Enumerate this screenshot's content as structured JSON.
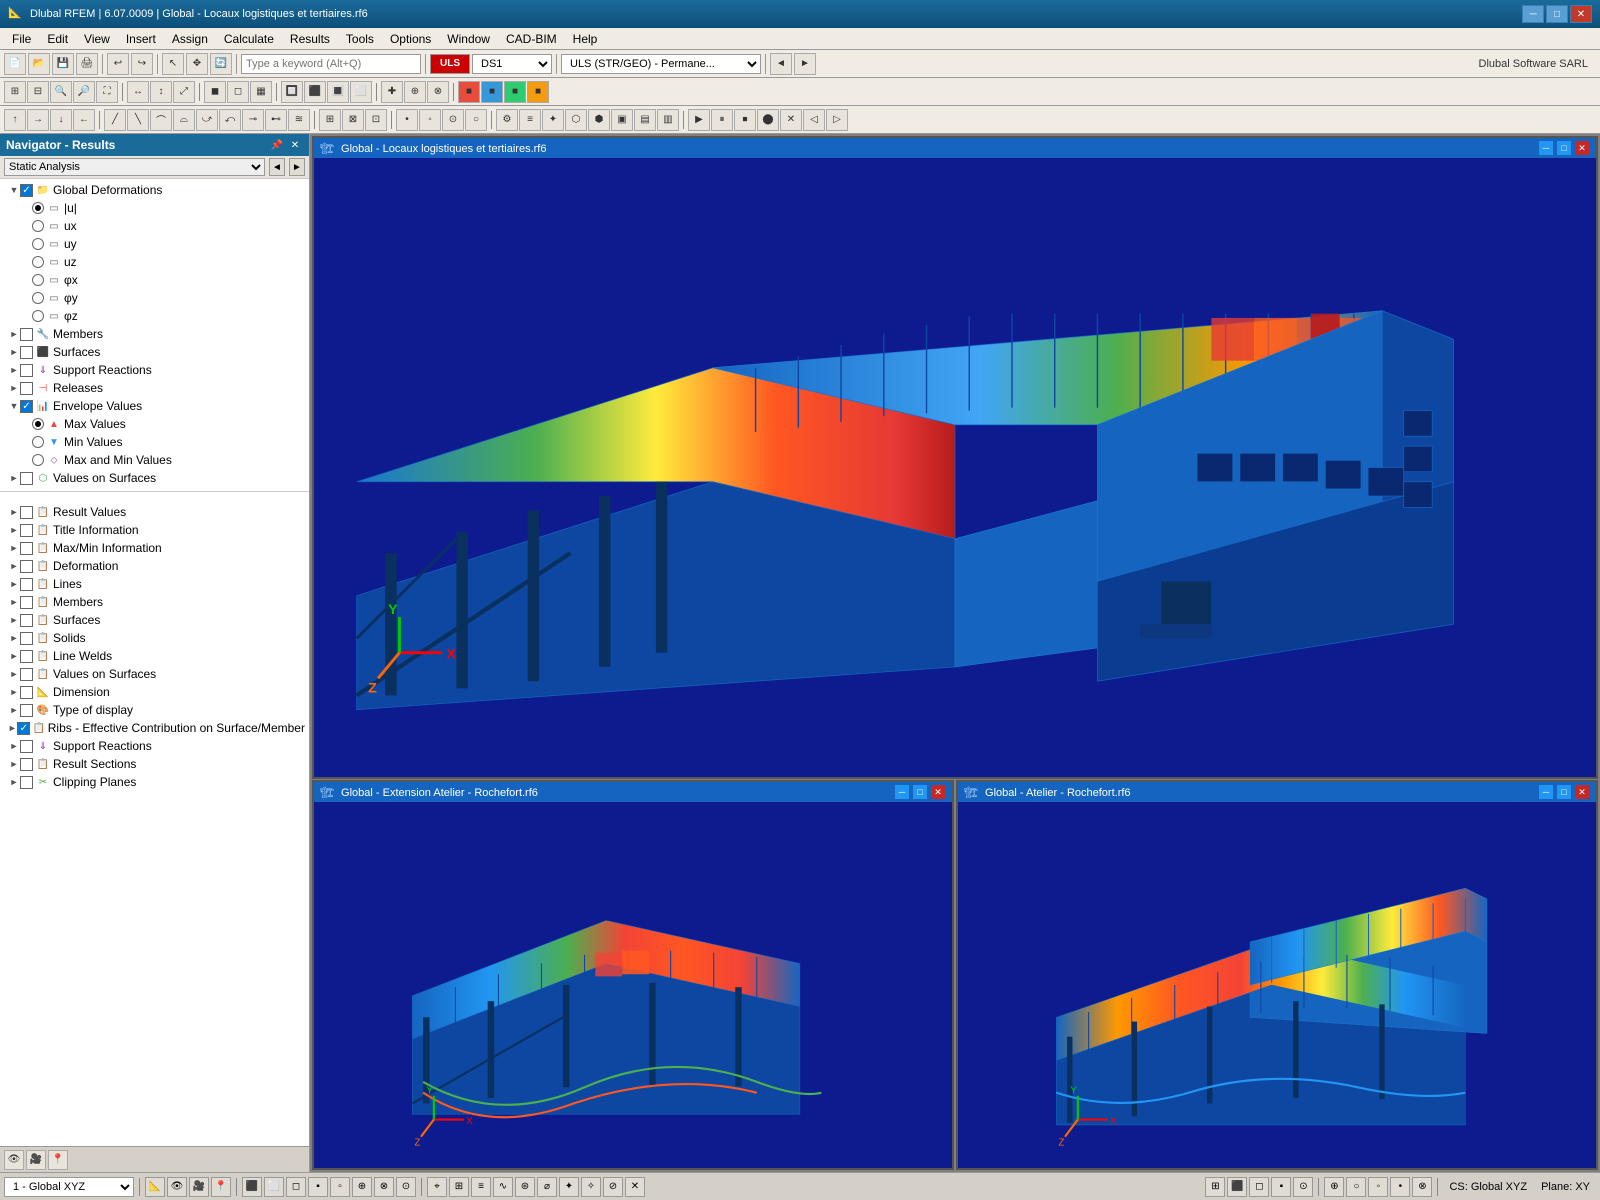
{
  "titleBar": {
    "icon": "📐",
    "text": "Dlubal RFEM | 6.07.0009 | Global - Locaux logistiques et tertiaires.rf6",
    "minimize": "─",
    "maximize": "□",
    "close": "✕"
  },
  "menuBar": {
    "items": [
      "File",
      "Edit",
      "View",
      "Insert",
      "Assign",
      "Calculate",
      "Results",
      "Tools",
      "Options",
      "Window",
      "CAD-BIM",
      "Help"
    ]
  },
  "toolbar1": {
    "searchPlaceholder": "Type a keyword (Alt+Q)",
    "combo1": "ULS DS1",
    "combo1color": "red",
    "combo2": "ULS (STR/GEO) - Permane...",
    "brandLabel": "Dlubal Software SARL"
  },
  "navigator": {
    "title": "Navigator - Results",
    "combo": "Static Analysis",
    "tree": {
      "globalDeformations": {
        "label": "Global Deformations",
        "expanded": true,
        "checked": true,
        "children": [
          {
            "label": "|u|",
            "radio": true,
            "checked": true
          },
          {
            "label": "ux",
            "radio": true,
            "checked": false
          },
          {
            "label": "uy",
            "radio": true,
            "checked": false
          },
          {
            "label": "uz",
            "radio": true,
            "checked": false
          },
          {
            "label": "φx",
            "radio": true,
            "checked": false
          },
          {
            "label": "φy",
            "radio": true,
            "checked": false
          },
          {
            "label": "φz",
            "radio": true,
            "checked": false
          }
        ]
      },
      "topItems": [
        {
          "label": "Members",
          "icon": "members",
          "checked": false,
          "expanded": false
        },
        {
          "label": "Surfaces",
          "icon": "surfaces",
          "checked": false,
          "expanded": false
        },
        {
          "label": "Support Reactions",
          "icon": "support",
          "checked": false,
          "expanded": false
        },
        {
          "label": "Releases",
          "icon": "releases",
          "checked": false,
          "expanded": false
        }
      ],
      "envelopeValues": {
        "label": "Envelope Values",
        "expanded": true,
        "checked": true,
        "children": [
          {
            "label": "Max Values",
            "radio": true,
            "checked": true
          },
          {
            "label": "Min Values",
            "radio": true,
            "checked": false
          },
          {
            "label": "Max and Min Values",
            "radio": true,
            "checked": false
          }
        ]
      },
      "valuesOnSurfaces": {
        "label": "Values on Surfaces",
        "icon": "values",
        "checked": false,
        "expanded": false
      },
      "resultSections": [
        {
          "label": "Result Values",
          "checked": false
        },
        {
          "label": "Title Information",
          "checked": false
        },
        {
          "label": "Max/Min Information",
          "checked": false
        },
        {
          "label": "Deformation",
          "checked": false
        },
        {
          "label": "Lines",
          "checked": false
        },
        {
          "label": "Members",
          "checked": false
        },
        {
          "label": "Surfaces",
          "checked": false
        },
        {
          "label": "Solids",
          "checked": false
        },
        {
          "label": "Line Welds",
          "checked": false
        },
        {
          "label": "Values on Surfaces",
          "checked": false
        },
        {
          "label": "Dimension",
          "checked": false
        },
        {
          "label": "Type of display",
          "checked": false
        },
        {
          "label": "Ribs - Effective Contribution on Surface/Member",
          "checked": true
        },
        {
          "label": "Support Reactions",
          "checked": false
        },
        {
          "label": "Result Sections",
          "checked": false
        },
        {
          "label": "Clipping Planes",
          "checked": false
        }
      ]
    }
  },
  "viewports": {
    "top": {
      "title": "Global - Locaux logistiques et tertiaires.rf6",
      "icon": "🏗"
    },
    "bottomLeft": {
      "title": "Global - Extension Atelier - Rochefort.rf6",
      "icon": "🏗"
    },
    "bottomRight": {
      "title": "Global - Atelier - Rochefort.rf6",
      "icon": "🏗"
    }
  },
  "statusBar": {
    "combo": "1 - Global XYZ",
    "csLabel": "CS: Global XYZ",
    "planeLabel": "Plane: XY"
  },
  "axes": {
    "x": "X",
    "y": "Y",
    "z": "Z"
  }
}
